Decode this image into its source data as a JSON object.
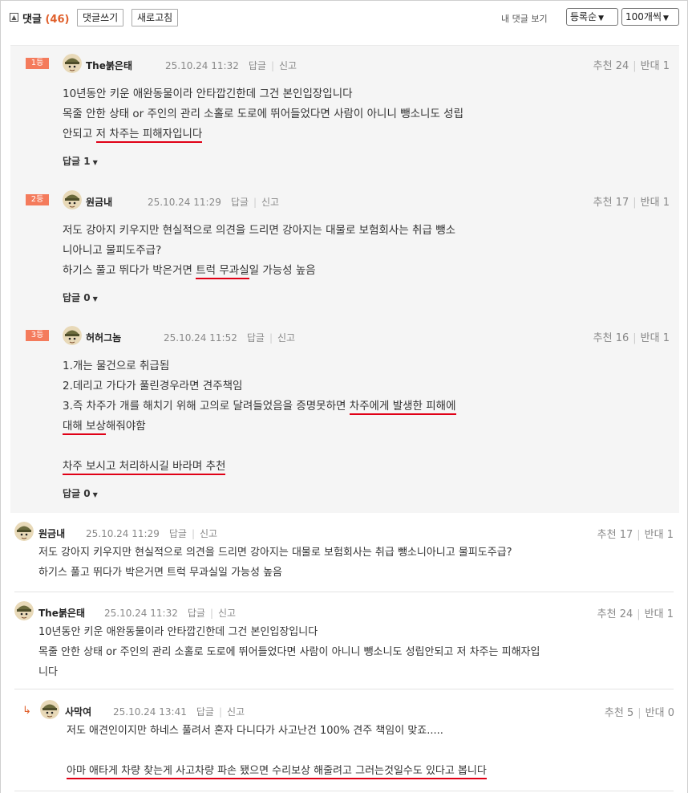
{
  "header": {
    "title": "댓글",
    "count": "(46)",
    "write_button": "댓글쓰기",
    "refresh_button": "새로고침",
    "my_comments": "내 댓글 보기",
    "sort_select": "등록순",
    "per_page_select": "100개씩"
  },
  "best": [
    {
      "rank": "1등",
      "nick": "The붉은태",
      "date": "25.10.24 11:32",
      "reply_action": "답글",
      "report_action": "신고",
      "up_label": "추천",
      "up": "24",
      "down_label": "반대",
      "down": "1",
      "lines": [
        {
          "pre": "10년동안 키운 애완동물이라 안타깝긴한데 그건 본인입장입니다",
          "mark": "",
          "post": ""
        },
        {
          "pre": "목줄 안한 상태 or 주인의 관리 소홀로 도로에 뛰어들었다면 사람이 아니니 뺑소니도 성립",
          "mark": "",
          "post": ""
        },
        {
          "pre": "안되고 ",
          "mark": "저 차주는 피해자입니다",
          "post": ""
        }
      ],
      "replies": "답글 1"
    },
    {
      "rank": "2등",
      "nick": "원금내",
      "date": "25.10.24 11:29",
      "reply_action": "답글",
      "report_action": "신고",
      "up_label": "추천",
      "up": "17",
      "down_label": "반대",
      "down": "1",
      "lines": [
        {
          "pre": "저도 강아지 키우지만 현실적으로 의견을 드리면 강아지는 대물로 보험회사는 취급 뺑소",
          "mark": "",
          "post": ""
        },
        {
          "pre": "니아니고 물피도주급?",
          "mark": "",
          "post": ""
        },
        {
          "pre": "하기스 풀고 뛰다가 박은거면 ",
          "mark": "트럭 무과실",
          "post": "일 가능성 높음"
        }
      ],
      "replies": "답글 0"
    },
    {
      "rank": "3등",
      "nick": "허허그놈",
      "date": "25.10.24 11:52",
      "reply_action": "답글",
      "report_action": "신고",
      "up_label": "추천",
      "up": "16",
      "down_label": "반대",
      "down": "1",
      "lines": [
        {
          "pre": "1.개는 물건으로 취급됨",
          "mark": "",
          "post": ""
        },
        {
          "pre": "2.데리고 가다가 풀린경우라면 견주책임",
          "mark": "",
          "post": ""
        },
        {
          "pre": "3.즉 차주가 개를 해치기 위해 고의로 달려들었음을 증명못하면 ",
          "mark": "차주에게 발생한 피해에",
          "post": ""
        },
        {
          "pre": "",
          "mark": "대해 보상",
          "post": "해줘야함"
        },
        {
          "pre": "",
          "mark": "",
          "post": ""
        },
        {
          "pre": "",
          "mark": "차주 보시고 처리하시길 바라며 추천",
          "post": ""
        }
      ],
      "replies": "답글 0"
    }
  ],
  "comments": [
    {
      "nick": "원금내",
      "date": "25.10.24 11:29",
      "reply_action": "답글",
      "report_action": "신고",
      "up_label": "추천",
      "up": "17",
      "down_label": "반대",
      "down": "1",
      "lines": [
        {
          "pre": "저도 강아지 키우지만 현실적으로 의견을 드리면 강아지는 대물로 보험회사는 취급 뺑소니아니고 물피도주급?",
          "mark": "",
          "post": ""
        },
        {
          "pre": "하기스 풀고 뛰다가 박은거면 트럭 무과실일 가능성 높음",
          "mark": "",
          "post": ""
        }
      ]
    },
    {
      "nick": "The붉은태",
      "date": "25.10.24 11:32",
      "reply_action": "답글",
      "report_action": "신고",
      "up_label": "추천",
      "up": "24",
      "down_label": "반대",
      "down": "1",
      "lines": [
        {
          "pre": "10년동안 키운 애완동물이라 안타깝긴한데 그건 본인입장입니다",
          "mark": "",
          "post": ""
        },
        {
          "pre": "목줄 안한 상태 or 주인의 관리 소홀로 도로에 뛰어들었다면 사람이 아니니 뺑소니도 성립안되고 저 차주는 피해자입",
          "mark": "",
          "post": ""
        },
        {
          "pre": "니다",
          "mark": "",
          "post": ""
        }
      ]
    },
    {
      "nick": "사막여",
      "date": "25.10.24 13:41",
      "reply_action": "답글",
      "report_action": "신고",
      "up_label": "추천",
      "up": "5",
      "down_label": "반대",
      "down": "0",
      "lines": [
        {
          "pre": "저도 애견인이지만 하네스 풀려서 혼자 다니다가 사고난건 100% 견주 책임이 맞죠.....",
          "mark": "",
          "post": ""
        },
        {
          "pre": "",
          "mark": "",
          "post": ""
        },
        {
          "pre": "",
          "mark": "아마 애타게 차량 찾는게 사고차량 파손 됐으면 수리보상 해줄려고 그러는것일수도 있다고 봅니다",
          "post": ""
        }
      ]
    }
  ],
  "colors": {
    "accent": "#e0602c",
    "rank_badge": "#f47b5c",
    "underline": "#e00016",
    "best_bg": "#f5f5f5"
  },
  "icons": {
    "fold": "collapse-square-icon",
    "reply_arrow": "reply-arrow-icon",
    "avatar": "soldier-helmet-avatar-icon",
    "dropdown": "chevron-down-icon"
  }
}
